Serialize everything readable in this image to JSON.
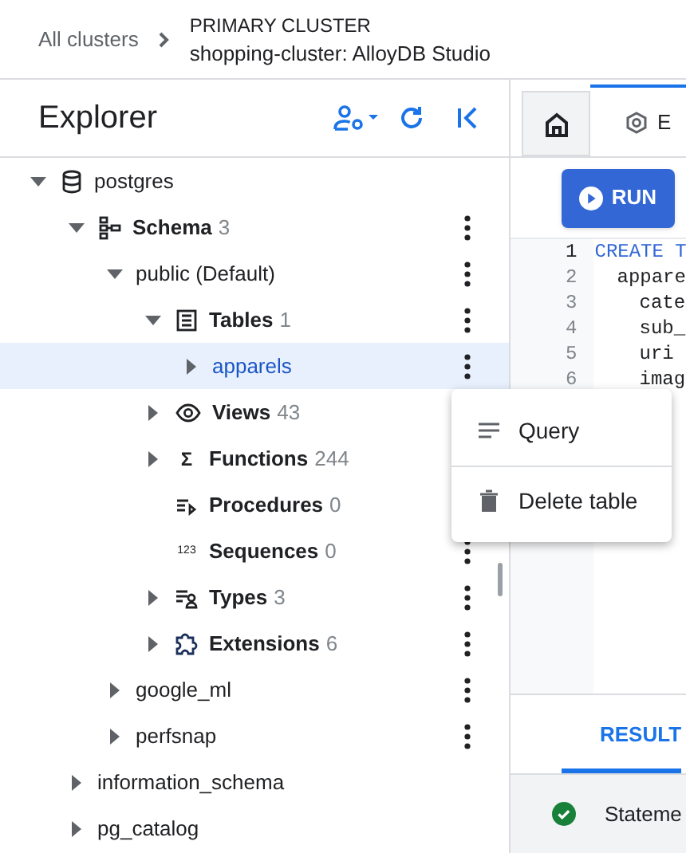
{
  "breadcrumb": {
    "link": "All clusters",
    "title": "PRIMARY CLUSTER",
    "subtitle": "shopping-cluster: AlloyDB Studio"
  },
  "explorer": {
    "title": "Explorer",
    "tree": [
      {
        "label": "postgres",
        "kind": "database",
        "expanded": true,
        "menu": false,
        "selected": false,
        "children": [
          {
            "label": "Schema",
            "count": "3",
            "kind": "schema",
            "expanded": true,
            "menu": true,
            "selected": false,
            "children": [
              {
                "label": "public (Default)",
                "expanded": true,
                "menu": true,
                "selected": false,
                "children": [
                  {
                    "label": "Tables",
                    "count": "1",
                    "kind": "table",
                    "expanded": true,
                    "menu": true,
                    "selected": false,
                    "children": [
                      {
                        "label": "apparels",
                        "expanded": false,
                        "menu": true,
                        "selected": true
                      }
                    ]
                  },
                  {
                    "label": "Views",
                    "count": "43",
                    "kind": "view",
                    "expanded": false,
                    "selected": false
                  },
                  {
                    "label": "Functions",
                    "count": "244",
                    "icon_text": "Σ",
                    "expanded": false,
                    "selected": false
                  },
                  {
                    "label": "Procedures",
                    "count": "0",
                    "kind": "procedure",
                    "selected": false
                  },
                  {
                    "label": "Sequences",
                    "count": "0",
                    "icon_text": "123",
                    "menu": true,
                    "selected": false
                  },
                  {
                    "label": "Types",
                    "count": "3",
                    "kind": "types",
                    "expanded": false,
                    "menu": true,
                    "selected": false
                  },
                  {
                    "label": "Extensions",
                    "count": "6",
                    "kind": "extension",
                    "expanded": false,
                    "menu": true,
                    "selected": false
                  }
                ]
              },
              {
                "label": "google_ml",
                "expanded": false,
                "menu": true,
                "selected": false
              },
              {
                "label": "perfsnap",
                "expanded": false,
                "menu": true,
                "selected": false
              }
            ]
          },
          {
            "label": "information_schema",
            "expanded": false,
            "menu": false,
            "selected": false
          },
          {
            "label": "pg_catalog",
            "expanded": false,
            "menu": false,
            "selected": false
          }
        ]
      }
    ]
  },
  "context_menu": [
    {
      "label": "Query",
      "kind": "query"
    },
    {
      "label": "Delete table",
      "kind": "delete"
    }
  ],
  "tabs": [
    {
      "kind": "home",
      "selected": false
    },
    {
      "kind": "editor",
      "label": "E",
      "selected": true
    }
  ],
  "run_button": "RUN",
  "code": [
    {
      "n": "1",
      "text": "CREATE T",
      "keyword": true
    },
    {
      "n": "2",
      "text": "appare",
      "keyword": false
    },
    {
      "n": "3",
      "text": "cate",
      "keyword": false
    },
    {
      "n": "4",
      "text": "sub_",
      "keyword": false
    },
    {
      "n": "5",
      "text": "uri",
      "keyword": false
    },
    {
      "n": "6",
      "text": "imag",
      "keyword": false
    }
  ],
  "results": {
    "tab": "RESULT",
    "status": "Stateme",
    "success": true
  }
}
